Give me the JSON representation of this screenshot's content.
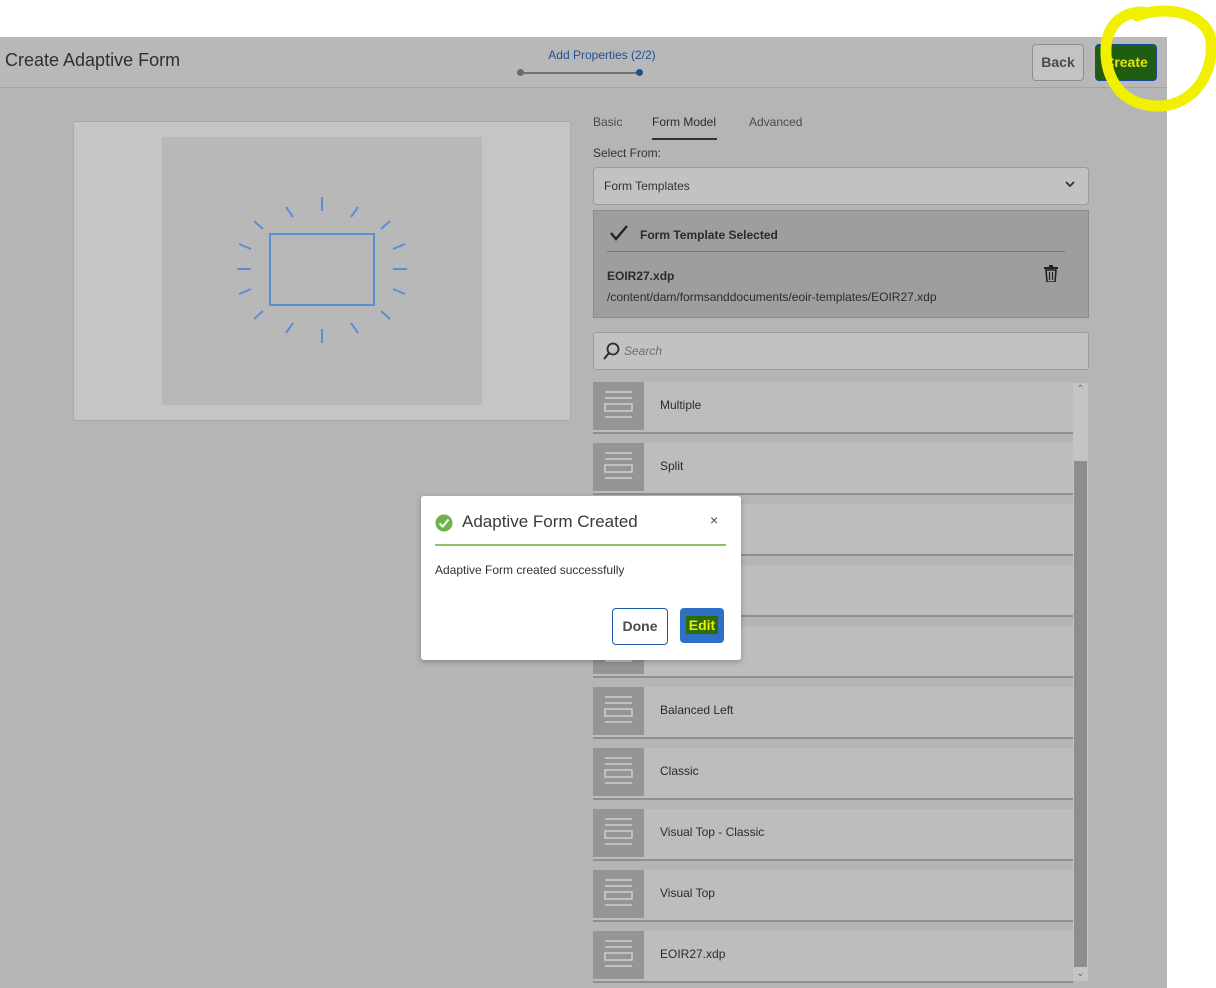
{
  "header": {
    "title": "Create Adaptive Form",
    "stepper_label": "Add Properties (2/2)",
    "back_label": "Back",
    "create_label": "Create"
  },
  "tabs": [
    {
      "label": "Basic",
      "active": false
    },
    {
      "label": "Form Model",
      "active": true
    },
    {
      "label": "Advanced",
      "active": false
    }
  ],
  "form_model": {
    "select_from_label": "Select From:",
    "select_from_value": "Form Templates",
    "selected_heading": "Form Template Selected",
    "selected_file": "EOIR27.xdp",
    "selected_path": "/content/dam/formsanddocuments/eoir-templates/EOIR27.xdp"
  },
  "search": {
    "placeholder": "Search"
  },
  "templates": [
    {
      "label": "Multiple"
    },
    {
      "label": "Split"
    },
    {
      "label": ""
    },
    {
      "label": ""
    },
    {
      "label": ""
    },
    {
      "label": "Balanced Left"
    },
    {
      "label": "Classic"
    },
    {
      "label": "Visual Top - Classic"
    },
    {
      "label": "Visual Top"
    },
    {
      "label": "EOIR27.xdp"
    }
  ],
  "dialog": {
    "title": "Adaptive Form Created",
    "close_glyph": "×",
    "message": "Adaptive Form created successfully",
    "done_label": "Done",
    "edit_label": "Edit"
  },
  "colors": {
    "accent_blue": "#2d70c5",
    "success_green": "#8cc36a",
    "highlight_yellow": "#f0f000"
  },
  "icons": [
    "chevron-down-icon",
    "checkmark-icon",
    "trash-icon",
    "search-icon",
    "check-circle-icon",
    "close-icon",
    "template-icon"
  ]
}
